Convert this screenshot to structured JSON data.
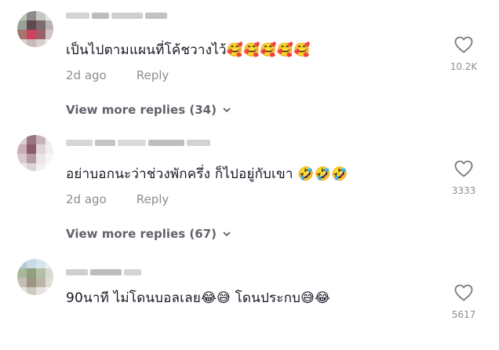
{
  "comments": [
    {
      "text": "เป็นไปตามแผนที่โค้ชวางไว้",
      "emojis": "🥰🥰🥰🥰🥰",
      "time": "2d ago",
      "reply_label": "Reply",
      "likes": "10.2K",
      "view_more": "View more replies (34)"
    },
    {
      "text": "อย่าบอกนะว่าช่วงพักครึ่ง ก็ไปอยู่กับเขา",
      "emojis": "🤣🤣🤣",
      "time": "2d ago",
      "reply_label": "Reply",
      "likes": "3333",
      "view_more": "View more replies (67)"
    },
    {
      "text": "90นาที ไม่โดนบอลเลย",
      "emojis_mid": "😂😅",
      "text2": "โดนประกบ",
      "emojis_end": "😅😂",
      "likes": "5617"
    }
  ],
  "colors": {
    "text": "#161823",
    "muted": "rgba(22,24,35,0.5)",
    "view_more": "rgba(22,24,35,0.68)"
  },
  "icons": [
    "heart-icon",
    "chevron-down-icon"
  ]
}
